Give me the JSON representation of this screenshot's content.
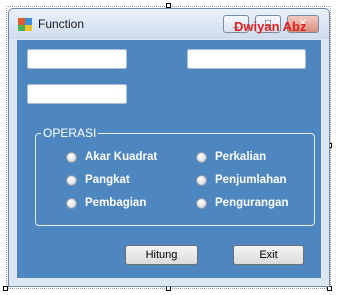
{
  "window": {
    "title": "Function",
    "watermark": "Dwiyan Abz"
  },
  "title_buttons": {
    "minimize_glyph": "_",
    "maximize_glyph": "□",
    "close_glyph": "✕"
  },
  "inputs": [
    {
      "value": ""
    },
    {
      "value": ""
    },
    {
      "value": ""
    }
  ],
  "operasi": {
    "label": "OPERASI",
    "options": [
      {
        "label": "Akar Kuadrat",
        "checked": false
      },
      {
        "label": "Perkalian",
        "checked": false
      },
      {
        "label": "Pangkat",
        "checked": false
      },
      {
        "label": "Penjumlahan",
        "checked": false
      },
      {
        "label": "Pembagian",
        "checked": false
      },
      {
        "label": "Pengurangan",
        "checked": false
      }
    ]
  },
  "buttons": {
    "hitung": "Hitung",
    "exit": "Exit"
  },
  "colors": {
    "client_background": "#4e86bf",
    "watermark": "#e02020"
  }
}
